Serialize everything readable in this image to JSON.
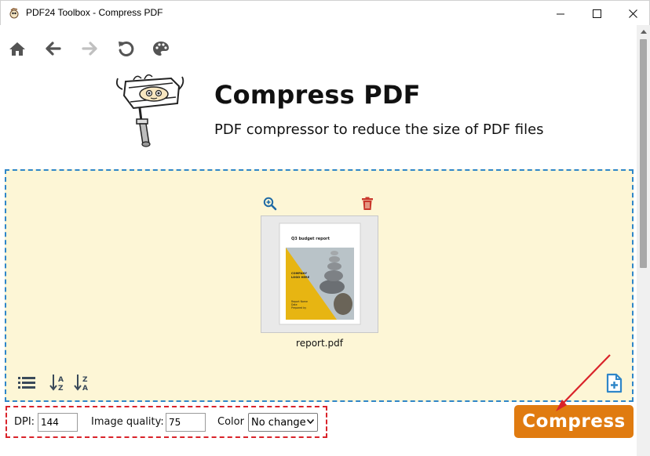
{
  "window": {
    "title": "PDF24 Toolbox - Compress PDF",
    "minimize_glyph": "—",
    "maximize_glyph": "☐",
    "close_glyph": "✕"
  },
  "toolbar": {
    "icons": [
      "home-icon",
      "back-icon",
      "forward-icon",
      "reload-icon",
      "palette-icon"
    ]
  },
  "header": {
    "title": "Compress PDF",
    "subtitle": "PDF compressor to reduce the size of PDF files"
  },
  "dropzone": {
    "file": {
      "name": "report.pdf",
      "thumbnail": {
        "heading": "Q3 budget report",
        "company_line1": "COMPANY",
        "company_line2": "LOGO HERE",
        "footer_line1": "Report Name",
        "footer_line2": "Date",
        "footer_line3": "Prepared by"
      }
    },
    "sort_icons": [
      "list-view-icon",
      "sort-a-z-icon",
      "sort-z-a-icon"
    ],
    "add_icon": "add-file-icon"
  },
  "options": {
    "dpi_label": "DPI:",
    "dpi_value": "144",
    "quality_label": "Image quality:",
    "quality_value": "75",
    "color_label": "Color",
    "color_value": "No change"
  },
  "actions": {
    "compress_label": "Compress"
  },
  "colors": {
    "accent": "#e07b10",
    "dropzone_bg": "#fdf6d6",
    "dropzone_border": "#2f86c8",
    "icon_blue": "#2f86c8",
    "annotation_red": "#d9232a"
  }
}
